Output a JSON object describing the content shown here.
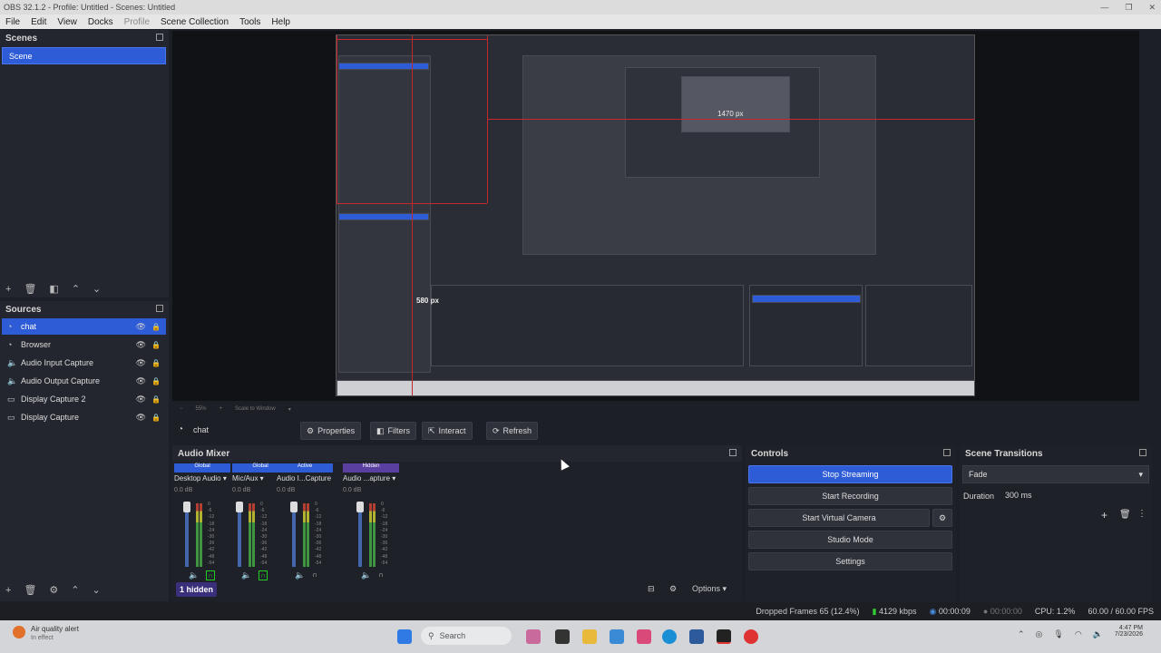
{
  "window": {
    "title": "OBS 32.1.2 - Profile: Untitled - Scenes: Untitled"
  },
  "menu": [
    "File",
    "Edit",
    "View",
    "Docks",
    "Profile",
    "Scene Collection",
    "Tools",
    "Help"
  ],
  "scenes": {
    "title": "Scenes",
    "items": [
      "Scene"
    ]
  },
  "sources": {
    "title": "Sources",
    "items": [
      {
        "name": "chat",
        "icon": "browser-icon"
      },
      {
        "name": "Browser",
        "icon": "browser-icon"
      },
      {
        "name": "Audio Input Capture",
        "icon": "speaker-icon"
      },
      {
        "name": "Audio Output Capture",
        "icon": "speaker-icon"
      },
      {
        "name": "Display Capture 2",
        "icon": "monitor-icon"
      },
      {
        "name": "Display Capture",
        "icon": "monitor-icon"
      }
    ]
  },
  "preview": {
    "measure_horizontal": "1470 px",
    "measure_vertical": "580 px",
    "zoom": "55%",
    "scale_mode": "Scale to Window"
  },
  "source_toolbar": {
    "selected": "chat",
    "properties": "Properties",
    "filters": "Filters",
    "interact": "Interact",
    "refresh": "Refresh"
  },
  "audio_mixer": {
    "title": "Audio Mixer",
    "channels": [
      {
        "tag": "Global",
        "tag_color": "#2e5bd6",
        "name": "Desktop Audio",
        "db": "0.0 dB"
      },
      {
        "tag": "Global",
        "tag_color": "#2e5bd6",
        "name": "Mic/Aux",
        "db": "0.0 dB"
      },
      {
        "tag": "Active",
        "tag_color": "#2e5bd6",
        "name": "Audio I...Capture",
        "db": "0.0 dB"
      },
      {
        "tag": "Hidden",
        "tag_color": "#5a3fa0",
        "name": "Audio ...apture",
        "db": "0.0 dB"
      }
    ],
    "meter_ticks": [
      "0",
      "-6",
      "-12",
      "-18",
      "-24",
      "-30",
      "-36",
      "-42",
      "-48",
      "-54",
      "-60"
    ],
    "hidden_badge": "1 hidden",
    "options": "Options"
  },
  "controls": {
    "title": "Controls",
    "stop_streaming": "Stop Streaming",
    "start_recording": "Start Recording",
    "start_virtual_camera": "Start Virtual Camera",
    "studio_mode": "Studio Mode",
    "settings": "Settings"
  },
  "transitions": {
    "title": "Scene Transitions",
    "selected": "Fade",
    "duration_label": "Duration",
    "duration_value": "300 ms"
  },
  "status": {
    "dropped_frames": "Dropped Frames 65 (12.4%)",
    "bitrate": "4129 kbps",
    "stream_time": "00:00:09",
    "rec_time": "00:00:00",
    "cpu": "CPU: 1.2%",
    "fps": "60.00 / 60.00 FPS"
  },
  "taskbar": {
    "notification_title": "Air quality alert",
    "notification_sub": "In effect",
    "search": "Search",
    "time": "4:47 PM",
    "date": "7/23/2026"
  }
}
